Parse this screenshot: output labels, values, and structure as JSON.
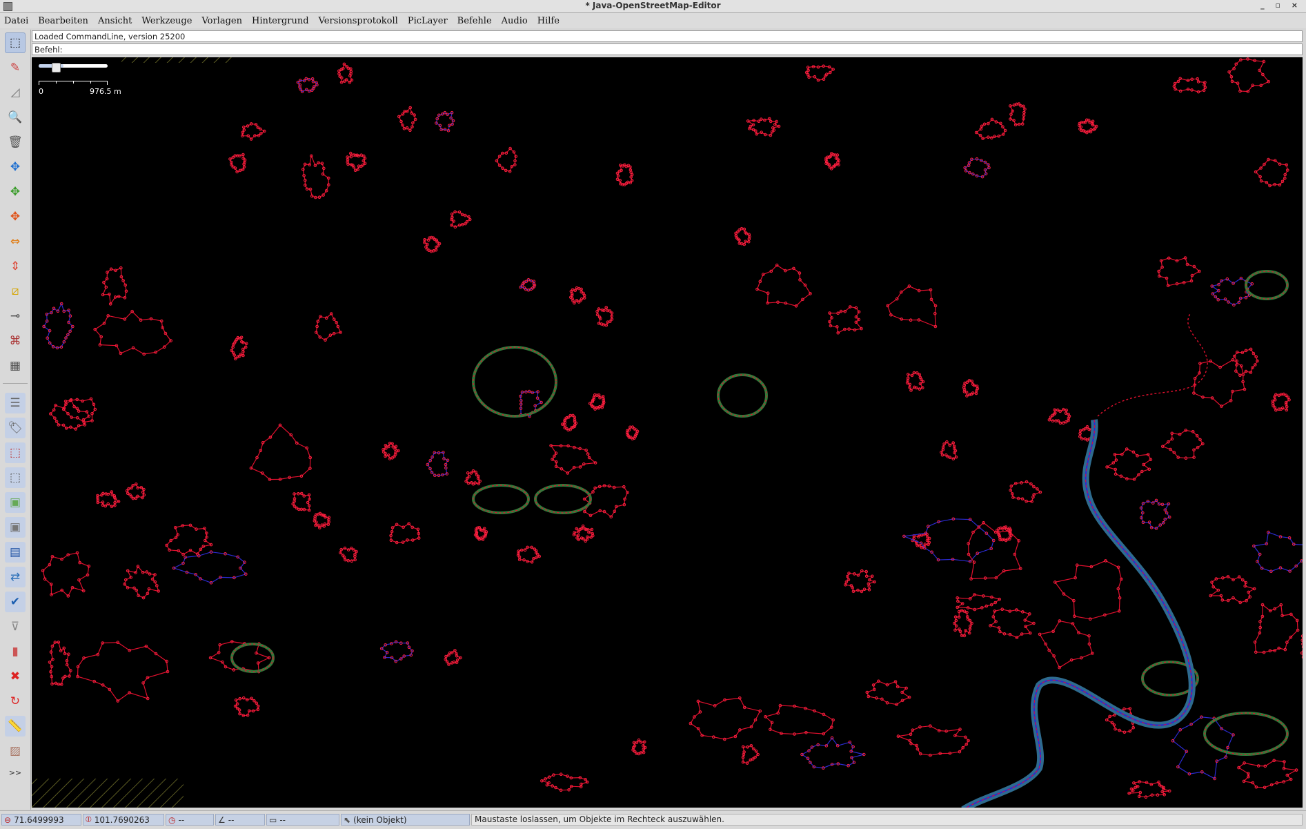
{
  "window": {
    "title": "* Java-OpenStreetMap-Editor",
    "controls": "_ ▫ ×"
  },
  "menu": {
    "items": [
      "Datei",
      "Bearbeiten",
      "Ansicht",
      "Werkzeuge",
      "Vorlagen",
      "Hintergrund",
      "Versionsprotokoll",
      "PicLayer",
      "Befehle",
      "Audio",
      "Hilfe"
    ]
  },
  "command_line": {
    "log": "Loaded CommandLine, version 25200",
    "prompt": "Befehl:"
  },
  "toolbar": {
    "tools": [
      {
        "icon": "select-icon",
        "glyph": "⬚"
      },
      {
        "icon": "draw-icon",
        "glyph": "✎"
      },
      {
        "icon": "measure-icon",
        "glyph": "◿"
      },
      {
        "icon": "zoom-icon",
        "glyph": "🔍"
      },
      {
        "icon": "delete-icon",
        "glyph": "🗑"
      },
      {
        "icon": "move-icon",
        "glyph": "✥"
      },
      {
        "icon": "rotate-icon",
        "glyph": "✥"
      },
      {
        "icon": "scale-icon",
        "glyph": "✥"
      },
      {
        "icon": "align-horizontal-icon",
        "glyph": "⇔"
      },
      {
        "icon": "align-vertical-icon",
        "glyph": "⇕"
      },
      {
        "icon": "parallel-icon",
        "glyph": "⧄"
      },
      {
        "icon": "extrude-icon",
        "glyph": "⊸"
      },
      {
        "icon": "improve-way-icon",
        "glyph": "⌘"
      },
      {
        "icon": "building-icon",
        "glyph": "▦"
      }
    ],
    "panels": [
      {
        "icon": "layers-icon",
        "glyph": "☰"
      },
      {
        "icon": "tags-icon",
        "glyph": "🏷"
      },
      {
        "icon": "selection-icon",
        "glyph": "⬚"
      },
      {
        "icon": "relations-icon",
        "glyph": "⬚"
      },
      {
        "icon": "image-icon",
        "glyph": "▣"
      },
      {
        "icon": "photo-icon",
        "glyph": "▣"
      },
      {
        "icon": "imagery-icon",
        "glyph": "▤"
      },
      {
        "icon": "conflict-icon",
        "glyph": "⇄"
      },
      {
        "icon": "validator-icon",
        "glyph": "✔"
      },
      {
        "icon": "filter-icon",
        "glyph": "⊽"
      },
      {
        "icon": "history-icon",
        "glyph": "▮"
      },
      {
        "icon": "close-icon",
        "glyph": "✖"
      },
      {
        "icon": "changeset-icon",
        "glyph": "↻"
      },
      {
        "icon": "ruler-icon",
        "glyph": "📏"
      },
      {
        "icon": "piclayer-icon",
        "glyph": "▨"
      }
    ],
    "more_label": ">>"
  },
  "map": {
    "background": "#000000",
    "outline_color": "#e0102e",
    "node_color": "#ff2040",
    "way_color": "#2b2bd1",
    "water_color": "#2e6b8f",
    "scale_min": "0",
    "scale_max": "976.5 m"
  },
  "statusbar": {
    "lat": "71.6499993",
    "lon": "101.7690263",
    "heading": "--",
    "angle": "--",
    "distance": "--",
    "selection": "(kein Objekt)",
    "help": "Maustaste loslassen, um Objekte im Rechteck auszuwählen."
  }
}
